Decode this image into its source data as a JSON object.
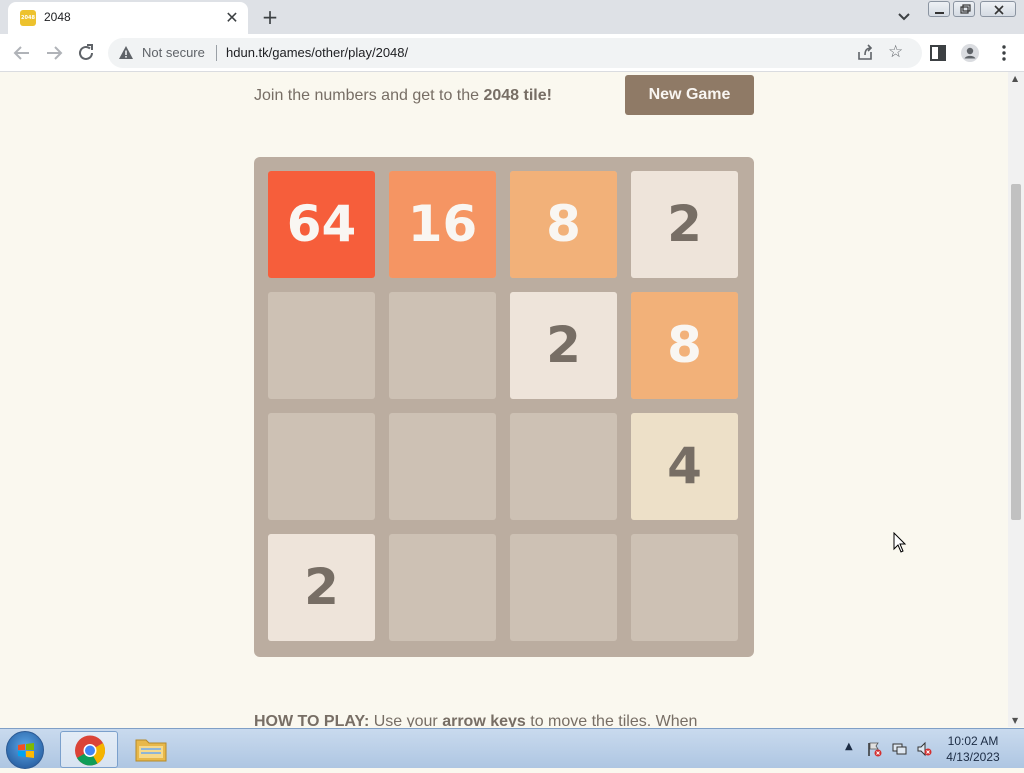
{
  "browser": {
    "tab_title": "2048",
    "favicon_text": "2048",
    "security_label": "Not secure",
    "url": "hdun.tk/games/other/play/2048/"
  },
  "game": {
    "intro_prefix": "Join the numbers and get to the ",
    "intro_bold": "2048 tile!",
    "new_game_label": "New Game",
    "grid": [
      [
        64,
        16,
        8,
        2
      ],
      [
        0,
        0,
        2,
        8
      ],
      [
        0,
        0,
        0,
        4
      ],
      [
        2,
        0,
        0,
        0
      ]
    ],
    "howto_label": "HOW TO PLAY:",
    "howto_text1": " Use your ",
    "howto_bold": "arrow keys",
    "howto_text2": " to move the tiles. When"
  },
  "taskbar": {
    "time": "10:02 AM",
    "date": "4/13/2023"
  },
  "colors": {
    "board": "#bbada0",
    "empty_cell": "#cdc1b4",
    "tile_2": "#eee4da",
    "tile_4": "#ede0c8",
    "tile_8": "#f2b179",
    "tile_16": "#f59563",
    "tile_64": "#f65e3b",
    "button": "#8f7a66"
  }
}
